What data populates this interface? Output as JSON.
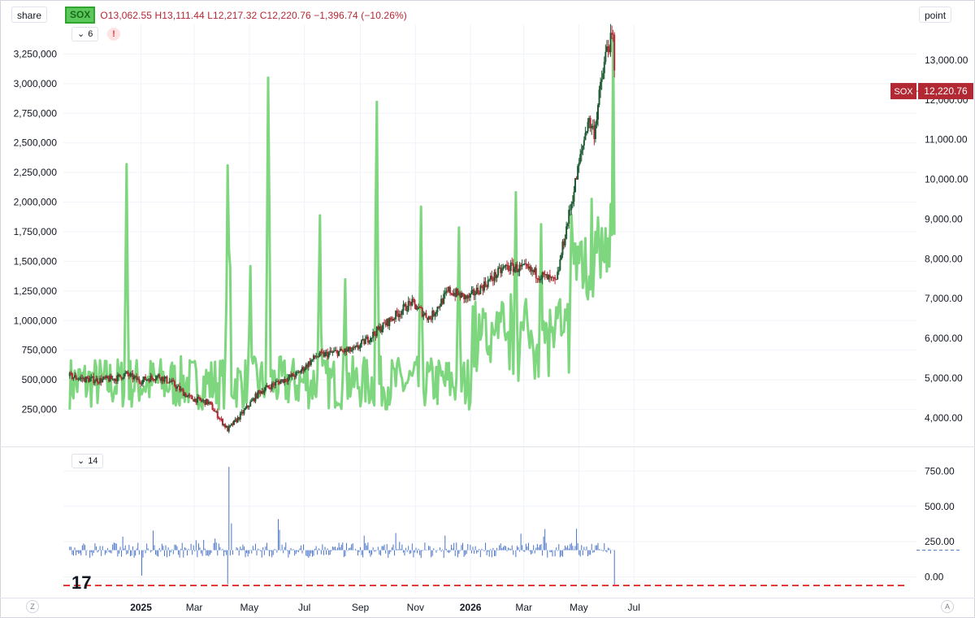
{
  "units": {
    "left": "share",
    "right": "point"
  },
  "legend": {
    "symbol": "SOX",
    "ohlc": "O13,062.55  H13,111.44  L12,217.32  C12,220.76  −1,396.74 (−10.26%)"
  },
  "pane1": {
    "indicator_param": "6",
    "warning_icon": "warning-icon"
  },
  "pane2": {
    "indicator_param": "14"
  },
  "price_tag": {
    "symbol": "SOX",
    "value": "12,220.76",
    "color": "#b22833"
  },
  "colors": {
    "volume_line": "#7ed67e",
    "candle_up": "#1e5a32",
    "candle_down": "#b22833",
    "histogram": "#4a74c9",
    "zero_line": "#e53935"
  },
  "chart_data": [
    {
      "type": "line",
      "description_series": "volume (share), left axis; candles (point), right axis",
      "x_ticks": [
        "2025",
        "Mar",
        "May",
        "Jul",
        "Sep",
        "Nov",
        "2026",
        "Mar",
        "May",
        "Jul"
      ],
      "left_axis_ticks": [
        "3,250,000",
        "3,000,000",
        "2,750,000",
        "2,500,000",
        "2,250,000",
        "2,000,000",
        "1,750,000",
        "1,500,000",
        "1,250,000",
        "1,000,000",
        "750,000",
        "500,000",
        "250,000"
      ],
      "right_axis_ticks": [
        "13,000.00",
        "12,000.00",
        "11,000.00",
        "10,000.00",
        "9,000.00",
        "8,000.00",
        "7,000.00",
        "6,000.00",
        "5,000.00",
        "4,000.00"
      ],
      "ylim_left": [
        0,
        3500000
      ],
      "ylim_right": [
        3300,
        13900
      ],
      "volume_spikes": [
        {
          "date": "2024-12-16",
          "value": 2320000
        },
        {
          "date": "2025-04-07",
          "value": 2310000
        },
        {
          "date": "2025-04-09",
          "value": 2020000
        },
        {
          "date": "2025-05-02",
          "value": 1570000
        },
        {
          "date": "2025-05-22",
          "value": 3280000
        },
        {
          "date": "2025-07-18",
          "value": 2030000
        },
        {
          "date": "2025-08-15",
          "value": 1450000
        },
        {
          "date": "2025-09-19",
          "value": 3060000
        },
        {
          "date": "2025-11-07",
          "value": 2110000
        },
        {
          "date": "2025-12-19",
          "value": 1920000
        },
        {
          "date": "2026-02-20",
          "value": 2240000
        },
        {
          "date": "2026-03-20",
          "value": 1950000
        },
        {
          "date": "2026-05-15",
          "value": 2180000
        },
        {
          "date": "2026-06-08",
          "value": 3380000
        }
      ],
      "price_points": [
        {
          "date": "2024-10-14",
          "close": 5050
        },
        {
          "date": "2024-10-28",
          "close": 4980
        },
        {
          "date": "2024-11-15",
          "close": 4950
        },
        {
          "date": "2024-12-02",
          "close": 4980
        },
        {
          "date": "2024-12-16",
          "close": 5100
        },
        {
          "date": "2024-12-30",
          "close": 4930
        },
        {
          "date": "2025-01-20",
          "close": 5050
        },
        {
          "date": "2025-02-03",
          "close": 4900
        },
        {
          "date": "2025-02-24",
          "close": 4500
        },
        {
          "date": "2025-03-17",
          "close": 4380
        },
        {
          "date": "2025-04-07",
          "close": 3700
        },
        {
          "date": "2025-04-21",
          "close": 4050
        },
        {
          "date": "2025-05-12",
          "close": 4650
        },
        {
          "date": "2025-06-02",
          "close": 4900
        },
        {
          "date": "2025-06-23",
          "close": 5100
        },
        {
          "date": "2025-07-14",
          "close": 5550
        },
        {
          "date": "2025-08-04",
          "close": 5650
        },
        {
          "date": "2025-08-25",
          "close": 5700
        },
        {
          "date": "2025-09-15",
          "close": 6100
        },
        {
          "date": "2025-10-06",
          "close": 6500
        },
        {
          "date": "2025-10-27",
          "close": 6900
        },
        {
          "date": "2025-11-17",
          "close": 6500
        },
        {
          "date": "2025-12-08",
          "close": 7200
        },
        {
          "date": "2025-12-29",
          "close": 7000
        },
        {
          "date": "2026-01-19",
          "close": 7400
        },
        {
          "date": "2026-02-09",
          "close": 7800
        },
        {
          "date": "2026-03-02",
          "close": 7750
        },
        {
          "date": "2026-03-23",
          "close": 7550
        },
        {
          "date": "2026-04-06",
          "close": 7400
        },
        {
          "date": "2026-04-13",
          "close": 8300
        },
        {
          "date": "2026-04-27",
          "close": 9900
        },
        {
          "date": "2026-05-11",
          "close": 11500
        },
        {
          "date": "2026-05-18",
          "close": 11200
        },
        {
          "date": "2026-05-25",
          "close": 12300
        },
        {
          "date": "2026-06-01",
          "close": 13300
        },
        {
          "date": "2026-06-08",
          "close": 13550
        },
        {
          "date": "2026-06-10",
          "close": 12220.76
        }
      ]
    },
    {
      "type": "bar",
      "description_series": "oscillator histogram, lower pane",
      "right_axis_ticks": [
        "750.00",
        "500.00",
        "250.00",
        "0.00"
      ],
      "ylim": [
        -60,
        850
      ],
      "baseline": 190,
      "spikes": [
        {
          "date": "2025-01-02",
          "value": 10
        },
        {
          "date": "2025-04-07",
          "value": -50
        },
        {
          "date": "2025-04-08",
          "value": 780
        },
        {
          "date": "2025-04-11",
          "value": 380
        },
        {
          "date": "2025-06-02",
          "value": 410
        },
        {
          "date": "2026-06-10",
          "value": -60
        }
      ],
      "zero_line_value": -60
    }
  ]
}
